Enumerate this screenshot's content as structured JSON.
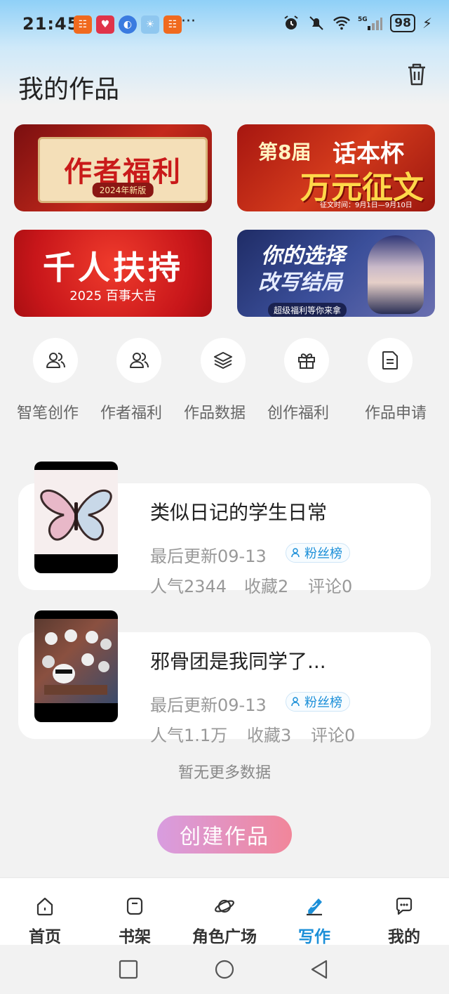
{
  "status_bar": {
    "time": "21:45",
    "network": "5G",
    "battery": "98",
    "more": "···"
  },
  "header": {
    "title": "我的作品"
  },
  "banners": [
    {
      "title": "作者福利",
      "subtitle": "2024年新版"
    },
    {
      "prefix": "第8届",
      "title": "话本杯",
      "main": "万元征文",
      "foot": "征文时间：9月1日—9月10日"
    },
    {
      "title": "千人扶持",
      "subtitle": "2025 百事大吉"
    },
    {
      "line1": "你的选择",
      "line2": "改写结局",
      "tag": "超级福利等你来拿"
    }
  ],
  "quick_links": [
    {
      "label": "智笔创作",
      "icon": "users-icon"
    },
    {
      "label": "作者福利",
      "icon": "users-icon"
    },
    {
      "label": "作品数据",
      "icon": "layers-icon"
    },
    {
      "label": "创作福利",
      "icon": "gift-icon"
    },
    {
      "label": "作品申请",
      "icon": "document-icon"
    }
  ],
  "works": [
    {
      "title": "类似日记的学生日常",
      "update": "最后更新09-13",
      "badge": "粉丝榜",
      "popularity": "人气2344",
      "favorites": "收藏2",
      "comments": "评论0"
    },
    {
      "title": "邪骨团是我同学了...",
      "update": "最后更新09-13",
      "badge": "粉丝榜",
      "popularity": "人气1.1万",
      "favorites": "收藏3",
      "comments": "评论0"
    }
  ],
  "list_footer": "暂无更多数据",
  "create_button": "创建作品",
  "bottom_nav": [
    {
      "label": "首页",
      "icon": "home-icon"
    },
    {
      "label": "书架",
      "icon": "bookshelf-icon"
    },
    {
      "label": "角色广场",
      "icon": "planet-icon"
    },
    {
      "label": "写作",
      "icon": "write-icon",
      "active": true
    },
    {
      "label": "我的",
      "icon": "chat-icon"
    }
  ],
  "colors": {
    "accent": "#1b8fd8",
    "create_gradient_start": "#d89de0",
    "create_gradient_end": "#f1869a"
  }
}
